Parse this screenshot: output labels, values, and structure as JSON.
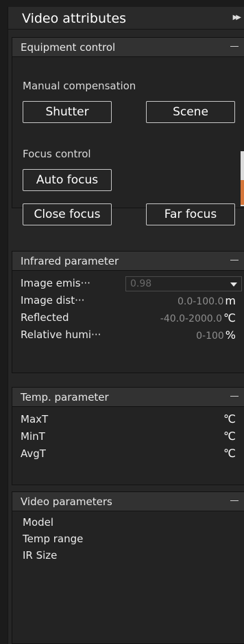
{
  "panel": {
    "title": "Video attributes",
    "title_icon": "double-chevron-right-icon"
  },
  "equipment": {
    "header": "Equipment control",
    "manual_label": "Manual compensation",
    "shutter": "Shutter",
    "scene": "Scene",
    "focus_label": "Focus control",
    "auto_focus": "Auto focus",
    "close_focus": "Close focus",
    "far_focus": "Far focus"
  },
  "infrared": {
    "header": "Infrared parameter",
    "rows": [
      {
        "label": "Image emis···",
        "value": "0.98"
      },
      {
        "label": "Image dist···",
        "value": "0.0-100.0",
        "unit": "m"
      },
      {
        "label": "Reflected",
        "value": "-40.0-2000.0",
        "unit": "℃"
      },
      {
        "label": "Relative humi···",
        "value": "0-100",
        "unit": "%"
      }
    ]
  },
  "temp": {
    "header": "Temp. parameter",
    "rows": [
      {
        "label": "MaxT",
        "unit": "℃"
      },
      {
        "label": "MinT",
        "unit": "℃"
      },
      {
        "label": "AvgT",
        "unit": "℃"
      }
    ]
  },
  "video": {
    "header": "Video parameters",
    "rows": [
      {
        "label": "Model"
      },
      {
        "label": "Temp range"
      },
      {
        "label": "IR Size"
      }
    ]
  },
  "colors": {
    "accent": "#d5763a",
    "border": "#c8c8c8"
  }
}
